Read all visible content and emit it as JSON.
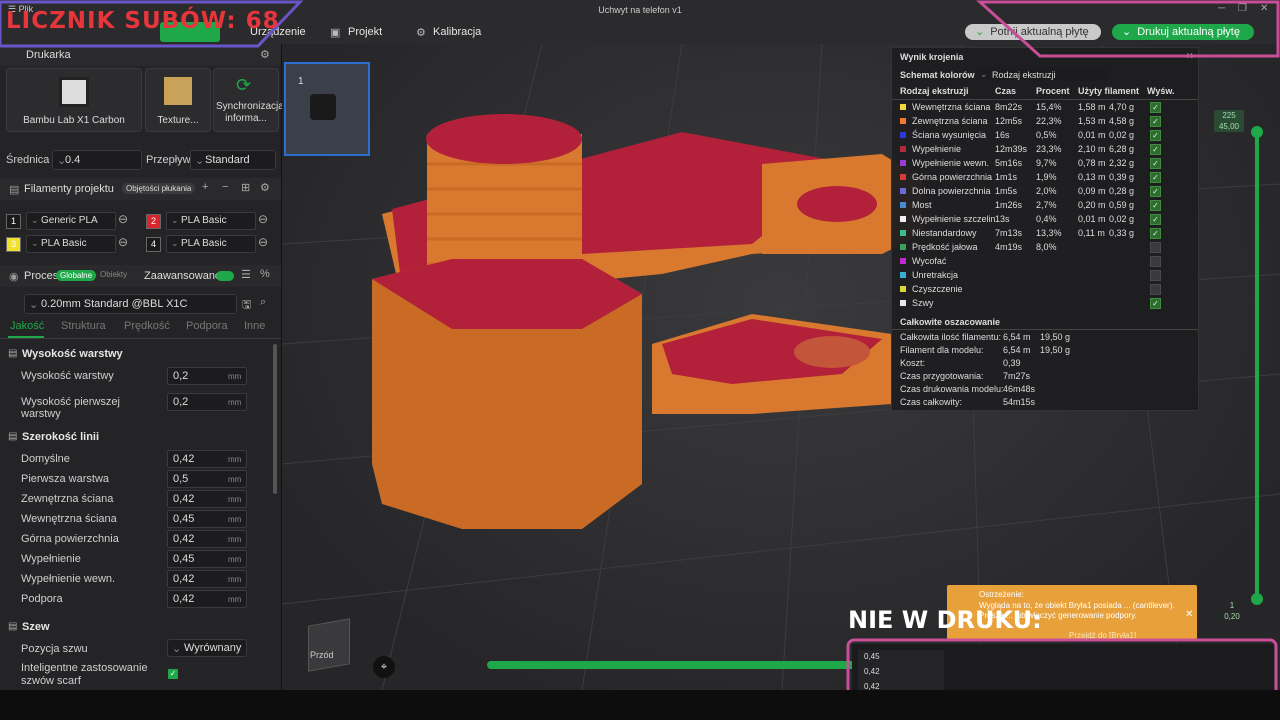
{
  "window": {
    "title": "Uchwyt na telefon v1",
    "menu": "Plik"
  },
  "toolbar": {
    "items": [
      "Urządzenie",
      "Projekt",
      "Kalibracja"
    ],
    "slice_button": "Potnij aktualną płytę",
    "print_button": "Drukuj aktualną płytę"
  },
  "overlay": {
    "counter": "LICZNIK SUBÓW: 68",
    "banner": "NIE W DRUKU:"
  },
  "printer": {
    "section": "Drukarka",
    "name": "Bambu Lab X1 Carbon",
    "plate": "Texture...",
    "sync": "Synchronizacja informa...",
    "nozzle_label": "Średnica",
    "nozzle_value": "0.4",
    "flow_label": "Przepływ",
    "flow_value": "Standard"
  },
  "filaments": {
    "section": "Filamenty projektu",
    "purge_badge": "Objętości płukania",
    "items": [
      {
        "num": "1",
        "name": "Generic PLA",
        "color": "#1a1a1a"
      },
      {
        "num": "2",
        "name": "PLA Basic",
        "color": "#d8262c"
      },
      {
        "num": "3",
        "name": "PLA Basic",
        "color": "#f0e02a"
      },
      {
        "num": "4",
        "name": "PLA Basic",
        "color": "#1a1a1a"
      }
    ]
  },
  "process": {
    "section": "Proces",
    "badge_global": "Globalne",
    "badge_objects": "Obiekty",
    "advanced": "Zaawansowane",
    "preset": "0.20mm Standard @BBL X1C",
    "tabs": [
      "Jakość",
      "Struktura",
      "Prędkość",
      "Podpora",
      "Inne"
    ],
    "layer_height": {
      "title": "Wysokość warstwy",
      "rows": [
        {
          "label": "Wysokość warstwy",
          "value": "0,2",
          "unit": "mm"
        },
        {
          "label": "Wysokość pierwszej warstwy",
          "value": "0,2",
          "unit": "mm"
        }
      ]
    },
    "line_width": {
      "title": "Szerokość linii",
      "rows": [
        {
          "label": "Domyślne",
          "value": "0,42",
          "unit": "mm"
        },
        {
          "label": "Pierwsza warstwa",
          "value": "0,5",
          "unit": "mm"
        },
        {
          "label": "Zewnętrzna ściana",
          "value": "0,42",
          "unit": "mm"
        },
        {
          "label": "Wewnętrzna ściana",
          "value": "0,45",
          "unit": "mm"
        },
        {
          "label": "Górna powierzchnia",
          "value": "0,42",
          "unit": "mm"
        },
        {
          "label": "Wypełnienie",
          "value": "0,45",
          "unit": "mm"
        },
        {
          "label": "Wypełnienie wewn.",
          "value": "0,42",
          "unit": "mm"
        },
        {
          "label": "Podpora",
          "value": "0,42",
          "unit": "mm"
        }
      ]
    },
    "seam": {
      "title": "Szew",
      "position_label": "Pozycja szwu",
      "position_value": "Wyrównany",
      "scarf_label": "Inteligentne zastosowanie szwów scarf"
    }
  },
  "plate_thumb": {
    "number": "1"
  },
  "slice_result": {
    "title": "Wynik krojenia",
    "scheme_label": "Schemat kolorów",
    "scheme_value": "Rodzaj ekstruzji",
    "headers": [
      "Rodzaj ekstruzji",
      "Czas",
      "Procent",
      "Użyty filament",
      "Wyśw."
    ],
    "rows": [
      {
        "name": "Wewnętrzna ściana",
        "time": "8m22s",
        "pct": "15,4%",
        "len": "1,58 m",
        "g": "4,70 g",
        "color": "#f2d83a",
        "on": true
      },
      {
        "name": "Zewnętrzna ściana",
        "time": "12m5s",
        "pct": "22,3%",
        "len": "1,53 m",
        "g": "4,58 g",
        "color": "#f07a2a",
        "on": true
      },
      {
        "name": "Ściana wysunięcia",
        "time": "16s",
        "pct": "0,5%",
        "len": "0,01 m",
        "g": "0,02 g",
        "color": "#2a3ae0",
        "on": true
      },
      {
        "name": "Wypełnienie",
        "time": "12m39s",
        "pct": "23,3%",
        "len": "2,10 m",
        "g": "6,28 g",
        "color": "#b02a3a",
        "on": true
      },
      {
        "name": "Wypełnienie wewn.",
        "time": "5m16s",
        "pct": "9,7%",
        "len": "0,78 m",
        "g": "2,32 g",
        "color": "#9a3ad0",
        "on": true
      },
      {
        "name": "Górna powierzchnia",
        "time": "1m1s",
        "pct": "1,9%",
        "len": "0,13 m",
        "g": "0,39 g",
        "color": "#d83a3a",
        "on": true
      },
      {
        "name": "Dolna powierzchnia",
        "time": "1m5s",
        "pct": "2,0%",
        "len": "0,09 m",
        "g": "0,28 g",
        "color": "#6a6ad8",
        "on": true
      },
      {
        "name": "Most",
        "time": "1m26s",
        "pct": "2,7%",
        "len": "0,20 m",
        "g": "0,59 g",
        "color": "#4a8ad0",
        "on": true
      },
      {
        "name": "Wypełnienie szczelin",
        "time": "13s",
        "pct": "0,4%",
        "len": "0,01 m",
        "g": "0,02 g",
        "color": "#f0f0f0",
        "on": true
      },
      {
        "name": "Niestandardowy",
        "time": "7m13s",
        "pct": "13,3%",
        "len": "0,11 m",
        "g": "0,33 g",
        "color": "#3ac08a",
        "on": true
      },
      {
        "name": "Prędkość jałowa",
        "time": "4m19s",
        "pct": "8,0%",
        "len": "",
        "g": "",
        "color": "#3aa05a",
        "on": false
      },
      {
        "name": "Wycofać",
        "time": "",
        "pct": "",
        "len": "",
        "g": "",
        "color": "#c02ad0",
        "on": false
      },
      {
        "name": "Unretrakcja",
        "time": "",
        "pct": "",
        "len": "",
        "g": "",
        "color": "#3ab0d0",
        "on": false
      },
      {
        "name": "Czyszczenie",
        "time": "",
        "pct": "",
        "len": "",
        "g": "",
        "color": "#d8d83a",
        "on": false
      },
      {
        "name": "Szwy",
        "time": "",
        "pct": "",
        "len": "",
        "g": "",
        "color": "#e8e8e8",
        "on": true
      }
    ],
    "summary_title": "Całkowite oszacowanie",
    "summary": [
      {
        "label": "Całkowita ilość filamentu:",
        "v1": "6,54 m",
        "v2": "19,50 g"
      },
      {
        "label": "Filament dla modelu:",
        "v1": "6,54 m",
        "v2": "19,50 g"
      },
      {
        "label": "Koszt:",
        "v1": "0,39",
        "v2": ""
      },
      {
        "label": "Czas przygotowania:",
        "v1": "7m27s",
        "v2": ""
      },
      {
        "label": "Czas drukowania modelu:",
        "v1": "46m48s",
        "v2": ""
      },
      {
        "label": "Czas całkowity:",
        "v1": "54m15s",
        "v2": ""
      }
    ]
  },
  "layer_slider": {
    "top_value": "225",
    "top_height": "45,00",
    "bottom_value": "1",
    "bottom_height": "0,20"
  },
  "warning": {
    "title": "Ostrzeżenie:",
    "text": "Wygląda na to, że obiekt Bryła1 posiada ... (cantilever). Proszę ... lub włączyć generowanie podpory.",
    "link": "Przejdź do [Bryła1]"
  },
  "view_cube": {
    "label": "Przód"
  },
  "inset_values": [
    "0,45",
    "0,42",
    "0,42"
  ],
  "colors": {
    "accent": "#1fa84a",
    "model": "#d9782f",
    "infill": "#b3203a"
  }
}
